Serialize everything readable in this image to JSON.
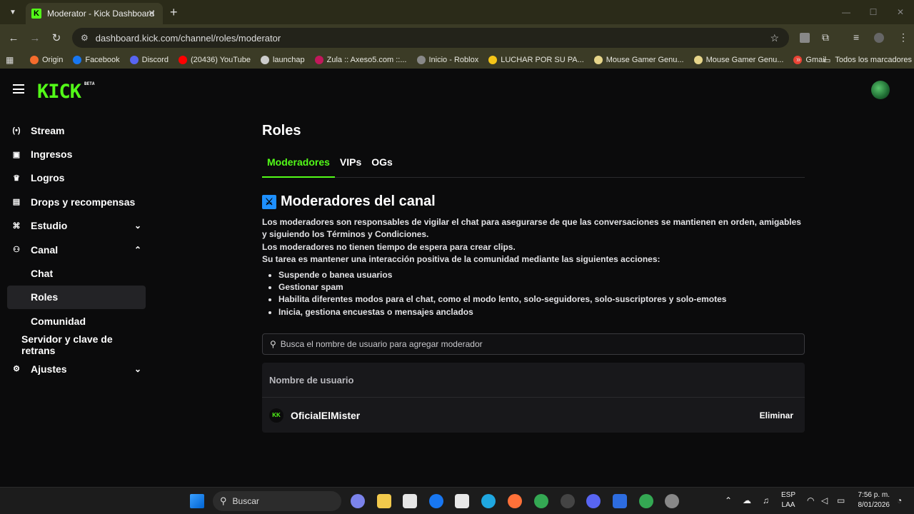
{
  "browser": {
    "tab_title": "Moderator - Kick Dashboard",
    "url": "dashboard.kick.com/channel/roles/moderator",
    "bookmarks": [
      {
        "label": "Origin",
        "color": "#f56c2d"
      },
      {
        "label": "Facebook",
        "color": "#1877f2"
      },
      {
        "label": "Discord",
        "color": "#5865f2"
      },
      {
        "label": "(20436) YouTube",
        "color": "#ff0000"
      },
      {
        "label": "launchap",
        "color": "#cccccc"
      },
      {
        "label": "Zula :: Axeso5.com ::...",
        "color": "#c2185b"
      },
      {
        "label": "Inicio - Roblox",
        "color": "#888888"
      },
      {
        "label": "LUCHAR POR SU PA...",
        "color": "#f5c518"
      },
      {
        "label": "Mouse Gamer Genu...",
        "color": "#e6d58a"
      },
      {
        "label": "Mouse Gamer Genu...",
        "color": "#e6d58a"
      },
      {
        "label": "Gmail",
        "color": "#ea4335"
      }
    ],
    "all_bookmarks": "Todos los marcadores"
  },
  "app": {
    "logo": "KICK",
    "logo_badge": "BETA"
  },
  "sidebar": {
    "items": [
      {
        "label": "Stream",
        "icon": "broadcast-icon"
      },
      {
        "label": "Ingresos",
        "icon": "chart-icon"
      },
      {
        "label": "Logros",
        "icon": "trophy-icon"
      },
      {
        "label": "Drops y recompensas",
        "icon": "drops-icon"
      },
      {
        "label": "Estudio",
        "icon": "studio-icon"
      },
      {
        "label": "Canal",
        "icon": "users-icon"
      },
      {
        "label": "Chat"
      },
      {
        "label": "Roles"
      },
      {
        "label": "Comunidad"
      },
      {
        "label": "Servidor y clave de retrans"
      },
      {
        "label": "Ajustes",
        "icon": "gear-icon"
      }
    ]
  },
  "main": {
    "title": "Roles",
    "tabs": [
      "Moderadores",
      "VIPs",
      "OGs"
    ],
    "section_title": "Moderadores del canal",
    "desc_1": "Los moderadores son responsables de vigilar el chat para asegurarse de que las conversaciones se mantienen en orden, amigables y siguiendo los Términos y Condiciones.",
    "desc_2": "Los moderadores no tienen tiempo de espera para crear clips.",
    "desc_3": "Su tarea es mantener una interacción positiva de la comunidad mediante las siguientes acciones:",
    "bullets": [
      "Suspende o banea usuarios",
      "Gestionar spam",
      "Habilita diferentes modos para el chat, como el modo lento, solo-seguidores, solo-suscriptores y solo-emotes",
      "Inicia, gestiona encuestas o mensajes anclados"
    ],
    "search_placeholder": "Busca el nombre de usuario para agregar moderador",
    "table_header": "Nombre de usuario",
    "moderator": {
      "name": "OficialElMister",
      "action": "Eliminar"
    }
  },
  "taskbar": {
    "search": "Buscar",
    "lang_1": "ESP",
    "lang_2": "LAA",
    "time": "7:56 p. m.",
    "date": "8/01/2026"
  }
}
